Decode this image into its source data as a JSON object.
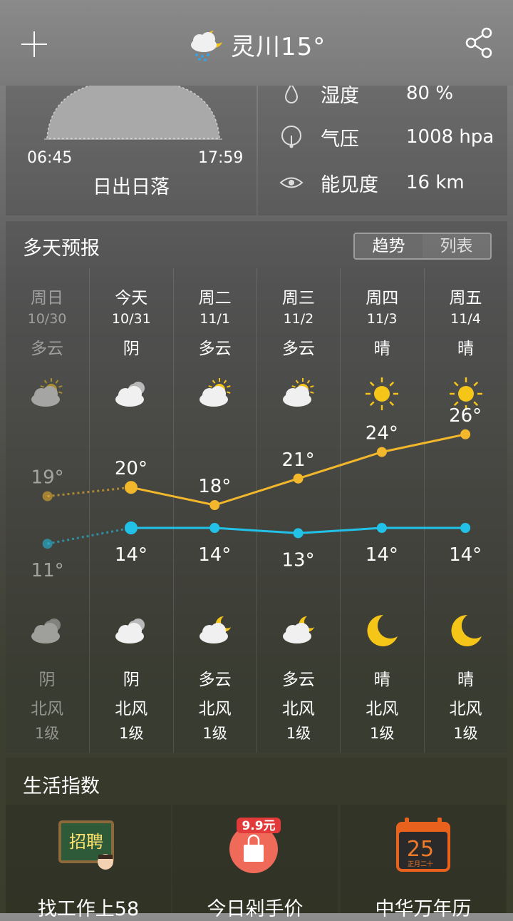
{
  "header": {
    "city_title": "灵川15°",
    "add_icon": "plus-icon",
    "share_icon": "share-icon",
    "weather_icon": "cloud-rain-moon-icon"
  },
  "sun": {
    "sunrise": "06:45",
    "sunset": "17:59",
    "label": "日出日落"
  },
  "stats": [
    {
      "icon": "humidity-icon",
      "label": "湿度",
      "value": "80 %"
    },
    {
      "icon": "pressure-icon",
      "label": "气压",
      "value": "1008 hpa"
    },
    {
      "icon": "visibility-icon",
      "label": "能见度",
      "value": "16 km"
    }
  ],
  "forecast": {
    "title": "多天预报",
    "toggle": [
      "趋势",
      "列表"
    ],
    "days": [
      {
        "day": "周日",
        "date": "10/30",
        "cond": "多云",
        "day_icon": "partly-cloudy-sun",
        "high": "19°",
        "low": "11°",
        "night_icon": "cloudy",
        "night_cond": "阴",
        "wind": "北风",
        "level": "1级"
      },
      {
        "day": "今天",
        "date": "10/31",
        "cond": "阴",
        "day_icon": "cloudy",
        "high": "20°",
        "low": "14°",
        "night_icon": "cloudy",
        "night_cond": "阴",
        "wind": "北风",
        "level": "1级"
      },
      {
        "day": "周二",
        "date": "11/1",
        "cond": "多云",
        "day_icon": "partly-cloudy-sun",
        "high": "18°",
        "low": "14°",
        "night_icon": "partly-cloudy-moon",
        "night_cond": "多云",
        "wind": "北风",
        "level": "1级"
      },
      {
        "day": "周三",
        "date": "11/2",
        "cond": "多云",
        "day_icon": "partly-cloudy-sun",
        "high": "21°",
        "low": "13°",
        "night_icon": "partly-cloudy-moon",
        "night_cond": "多云",
        "wind": "北风",
        "level": "1级"
      },
      {
        "day": "周四",
        "date": "11/3",
        "cond": "晴",
        "day_icon": "sun",
        "high": "24°",
        "low": "14°",
        "night_icon": "moon",
        "night_cond": "晴",
        "wind": "北风",
        "level": "1级"
      },
      {
        "day": "周五",
        "date": "11/4",
        "cond": "晴",
        "day_icon": "sun",
        "high": "26°",
        "low": "14°",
        "night_icon": "moon",
        "night_cond": "晴",
        "wind": "北风",
        "level": "1级"
      }
    ]
  },
  "chart_data": {
    "type": "line",
    "categories": [
      "周日",
      "今天",
      "周二",
      "周三",
      "周四",
      "周五"
    ],
    "series": [
      {
        "values": [
          19,
          20,
          18,
          21,
          24,
          26
        ]
      },
      {
        "values": [
          11,
          14,
          14,
          13,
          14,
          14
        ]
      }
    ],
    "colors": {
      "high": "#f2b72b",
      "low": "#22c2e8"
    }
  },
  "life": {
    "title": "生活指数",
    "tiles": [
      {
        "icon": "recruit-board-icon",
        "badge": "招聘",
        "label": "找工作上58"
      },
      {
        "icon": "shopping-bag-icon",
        "badge": "9.9元",
        "label": "今日剁手价"
      },
      {
        "icon": "calendar-icon",
        "badge": "25",
        "sub": "正月二十",
        "label": "中华万年历"
      }
    ]
  }
}
